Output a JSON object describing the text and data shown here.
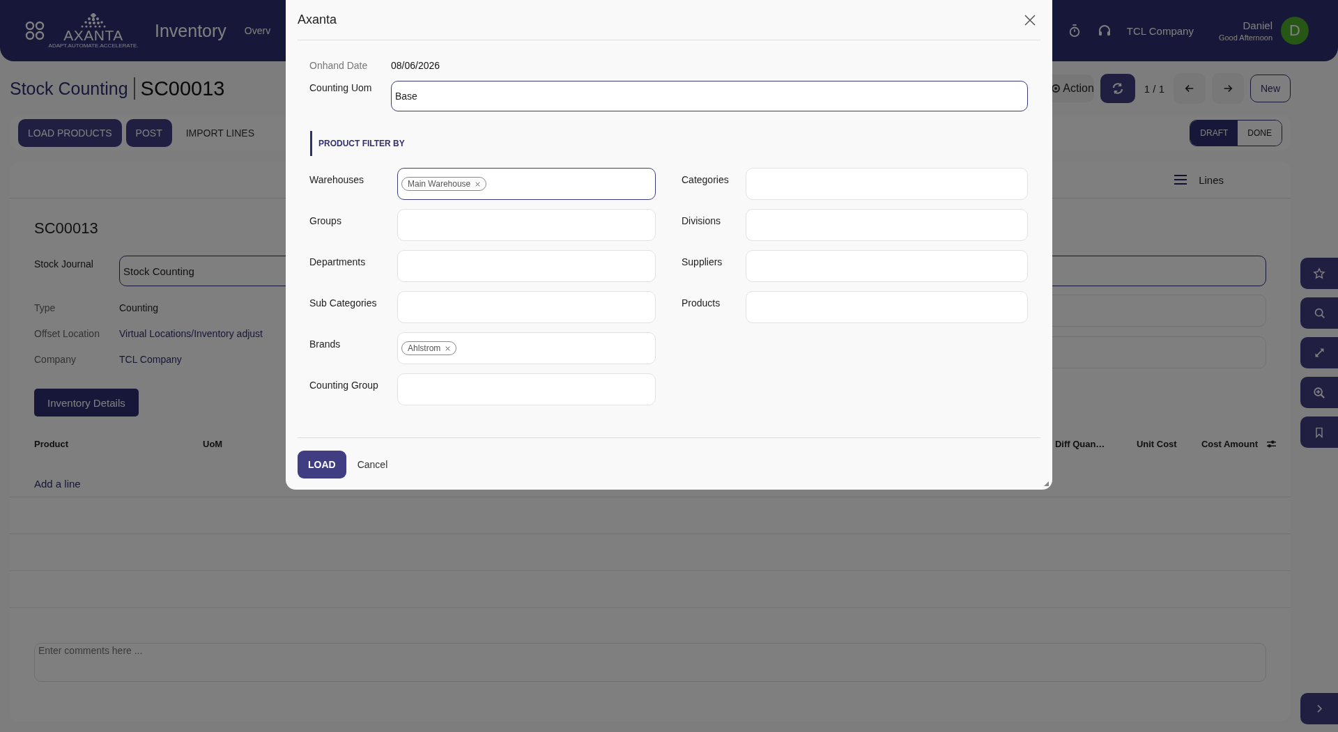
{
  "header": {
    "logo_text": "AXANTA",
    "logo_tagline": "ADAPT.AUTOMATE.ACCELERATE.",
    "app_title": "Inventory",
    "menu_partial": "Overv",
    "company": "TCL Company",
    "user_name": "Daniel",
    "greeting": "Good Afternoon",
    "avatar_initial": "D"
  },
  "breadcrumb": {
    "parent": "Stock Counting",
    "current": "SC00013"
  },
  "control_panel": {
    "action": "Action",
    "pager": "1 / 1",
    "new_button": "New"
  },
  "buttons": [
    {
      "label": "LOAD PRODUCTS",
      "kind": "primary"
    },
    {
      "label": "POST",
      "kind": "primary"
    },
    {
      "label": "IMPORT LINES",
      "kind": "link"
    }
  ],
  "status": [
    {
      "label": "DRAFT",
      "selected": true
    },
    {
      "label": "DONE",
      "selected": false
    }
  ],
  "notebook_tab": "Lines",
  "form": {
    "title": "SC00013",
    "journal_label": "Stock Journal",
    "journal_value": "Stock Counting",
    "fields": [
      {
        "label": "Type",
        "value": "Counting",
        "kind": "text"
      },
      {
        "label": "Offset Location",
        "value": "Virtual Locations/Inventory adjust",
        "kind": "link"
      },
      {
        "label": "Company",
        "value": "TCL Company",
        "kind": "link"
      }
    ],
    "details_button": "Inventory Details"
  },
  "table": {
    "columns": [
      "Product",
      "UoM",
      "Diff Quan…",
      "Unit Cost",
      "Cost Amount"
    ],
    "add_line": "Add a line"
  },
  "comments": {
    "placeholder": "Enter comments here ..."
  },
  "dialog": {
    "title": "Axanta",
    "onhand_label": "Onhand Date",
    "onhand_value": "08/06/2026",
    "uom_label": "Counting Uom",
    "uom_value": "Base",
    "section": "PRODUCT FILTER BY",
    "filters_left": [
      {
        "label": "Warehouses",
        "focused": true,
        "tags": [
          "Main Warehouse"
        ]
      },
      {
        "label": "Groups",
        "focused": false
      },
      {
        "label": "Departments",
        "focused": false
      },
      {
        "label": "Sub Categories",
        "focused": false
      },
      {
        "label": "Brands",
        "focused": false,
        "tags": [
          "Ahlstrom"
        ]
      },
      {
        "label": "Counting Group",
        "focused": false
      }
    ],
    "filters_right": [
      {
        "label": "Categories",
        "focused": false
      },
      {
        "label": "Divisions",
        "focused": false
      },
      {
        "label": "Suppliers",
        "focused": false
      },
      {
        "label": "Products",
        "focused": false
      }
    ],
    "buttons": [
      {
        "label": "LOAD",
        "kind": "primary"
      },
      {
        "label": "Cancel",
        "kind": "link"
      }
    ]
  }
}
